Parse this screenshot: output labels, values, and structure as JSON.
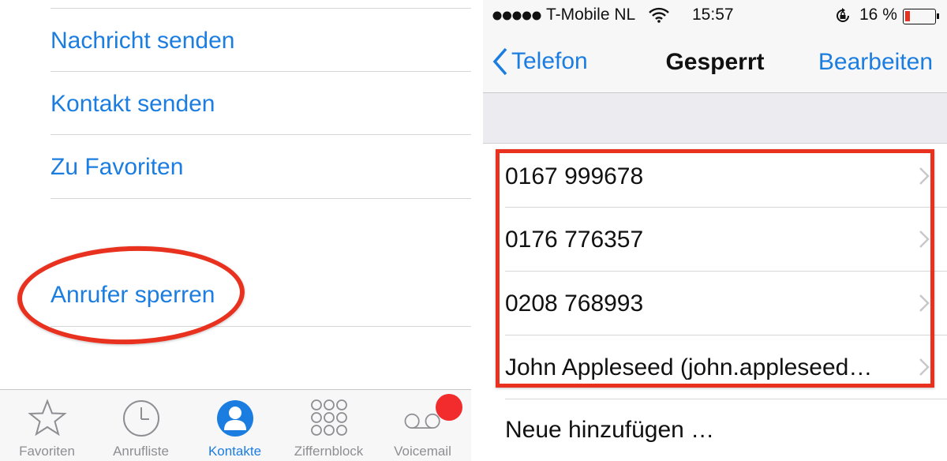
{
  "left_screen": {
    "menu_items": [
      {
        "label": "Nachricht senden"
      },
      {
        "label": "Kontakt senden"
      },
      {
        "label": "Zu Favoriten"
      },
      {
        "label": "Anrufer sperren"
      }
    ],
    "tabbar": {
      "tabs": [
        {
          "label": "Favoriten",
          "icon": "star-icon",
          "active": false
        },
        {
          "label": "Anrufliste",
          "icon": "clock-icon",
          "active": false
        },
        {
          "label": "Kontakte",
          "icon": "person-icon",
          "active": true
        },
        {
          "label": "Ziffernblock",
          "icon": "keypad-icon",
          "active": false
        },
        {
          "label": "Voicemail",
          "icon": "voicemail-icon",
          "active": false
        }
      ]
    }
  },
  "right_screen": {
    "status_bar": {
      "carrier": "T-Mobile NL",
      "time": "15:57",
      "battery_text": "16 %",
      "battery_level": 0.16
    },
    "nav_bar": {
      "back_label": "Telefon",
      "title": "Gesperrt",
      "edit_label": "Bearbeiten"
    },
    "blocked_list": [
      {
        "label": "0167 999678"
      },
      {
        "label": "0176 776357"
      },
      {
        "label": "0208 768993"
      },
      {
        "label": "John Appleseed (john.appleseed…"
      }
    ],
    "add_new_label": "Neue hinzufügen …"
  },
  "colors": {
    "accent": "#1c7de0",
    "annotation": "#e8321f",
    "badge": "#f22c2c",
    "battery": "#e8321f"
  }
}
